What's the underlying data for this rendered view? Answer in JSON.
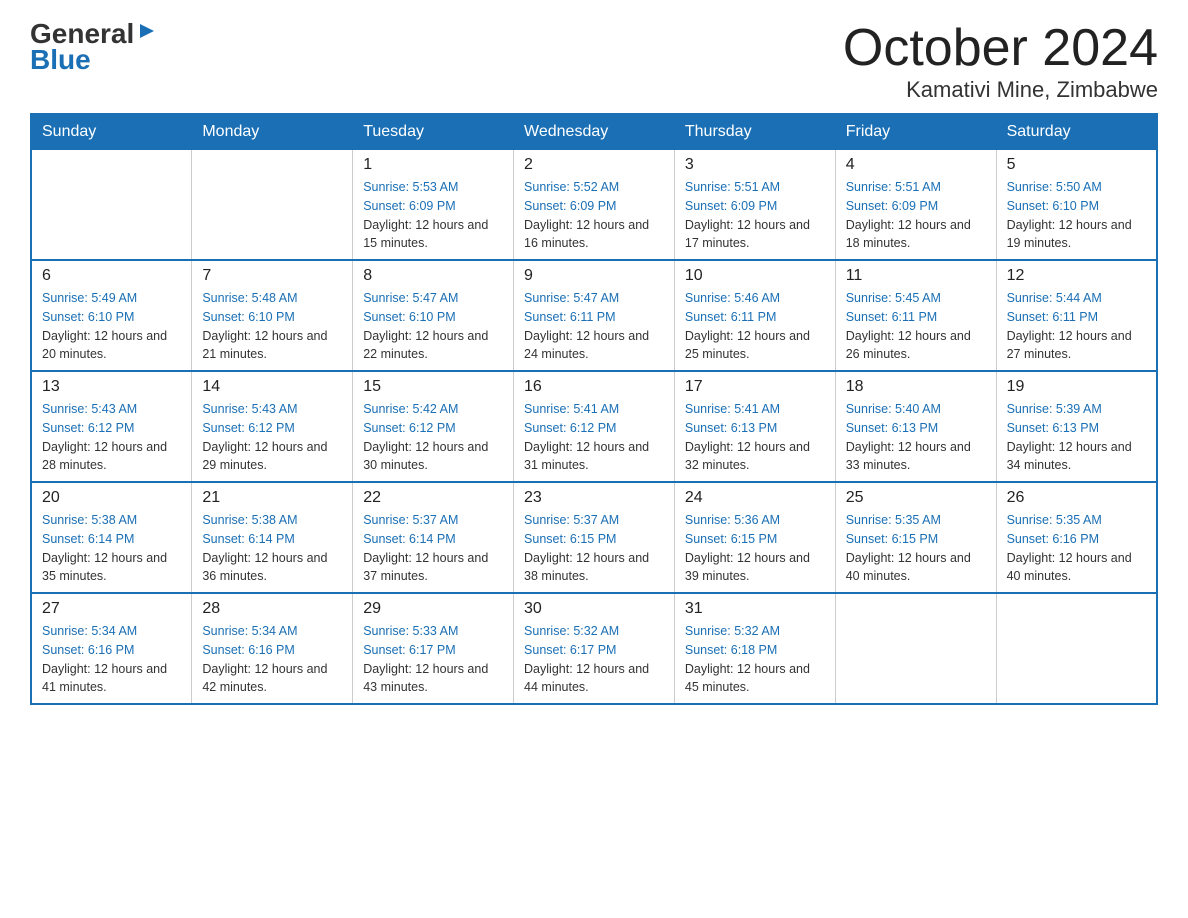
{
  "logo": {
    "general": "General",
    "arrow": "▶",
    "blue": "Blue"
  },
  "header": {
    "month": "October 2024",
    "location": "Kamativi Mine, Zimbabwe"
  },
  "days_of_week": [
    "Sunday",
    "Monday",
    "Tuesday",
    "Wednesday",
    "Thursday",
    "Friday",
    "Saturday"
  ],
  "weeks": [
    [
      {
        "day": "",
        "info": ""
      },
      {
        "day": "",
        "info": ""
      },
      {
        "day": "1",
        "sunrise": "Sunrise: 5:53 AM",
        "sunset": "Sunset: 6:09 PM",
        "daylight": "Daylight: 12 hours and 15 minutes."
      },
      {
        "day": "2",
        "sunrise": "Sunrise: 5:52 AM",
        "sunset": "Sunset: 6:09 PM",
        "daylight": "Daylight: 12 hours and 16 minutes."
      },
      {
        "day": "3",
        "sunrise": "Sunrise: 5:51 AM",
        "sunset": "Sunset: 6:09 PM",
        "daylight": "Daylight: 12 hours and 17 minutes."
      },
      {
        "day": "4",
        "sunrise": "Sunrise: 5:51 AM",
        "sunset": "Sunset: 6:09 PM",
        "daylight": "Daylight: 12 hours and 18 minutes."
      },
      {
        "day": "5",
        "sunrise": "Sunrise: 5:50 AM",
        "sunset": "Sunset: 6:10 PM",
        "daylight": "Daylight: 12 hours and 19 minutes."
      }
    ],
    [
      {
        "day": "6",
        "sunrise": "Sunrise: 5:49 AM",
        "sunset": "Sunset: 6:10 PM",
        "daylight": "Daylight: 12 hours and 20 minutes."
      },
      {
        "day": "7",
        "sunrise": "Sunrise: 5:48 AM",
        "sunset": "Sunset: 6:10 PM",
        "daylight": "Daylight: 12 hours and 21 minutes."
      },
      {
        "day": "8",
        "sunrise": "Sunrise: 5:47 AM",
        "sunset": "Sunset: 6:10 PM",
        "daylight": "Daylight: 12 hours and 22 minutes."
      },
      {
        "day": "9",
        "sunrise": "Sunrise: 5:47 AM",
        "sunset": "Sunset: 6:11 PM",
        "daylight": "Daylight: 12 hours and 24 minutes."
      },
      {
        "day": "10",
        "sunrise": "Sunrise: 5:46 AM",
        "sunset": "Sunset: 6:11 PM",
        "daylight": "Daylight: 12 hours and 25 minutes."
      },
      {
        "day": "11",
        "sunrise": "Sunrise: 5:45 AM",
        "sunset": "Sunset: 6:11 PM",
        "daylight": "Daylight: 12 hours and 26 minutes."
      },
      {
        "day": "12",
        "sunrise": "Sunrise: 5:44 AM",
        "sunset": "Sunset: 6:11 PM",
        "daylight": "Daylight: 12 hours and 27 minutes."
      }
    ],
    [
      {
        "day": "13",
        "sunrise": "Sunrise: 5:43 AM",
        "sunset": "Sunset: 6:12 PM",
        "daylight": "Daylight: 12 hours and 28 minutes."
      },
      {
        "day": "14",
        "sunrise": "Sunrise: 5:43 AM",
        "sunset": "Sunset: 6:12 PM",
        "daylight": "Daylight: 12 hours and 29 minutes."
      },
      {
        "day": "15",
        "sunrise": "Sunrise: 5:42 AM",
        "sunset": "Sunset: 6:12 PM",
        "daylight": "Daylight: 12 hours and 30 minutes."
      },
      {
        "day": "16",
        "sunrise": "Sunrise: 5:41 AM",
        "sunset": "Sunset: 6:12 PM",
        "daylight": "Daylight: 12 hours and 31 minutes."
      },
      {
        "day": "17",
        "sunrise": "Sunrise: 5:41 AM",
        "sunset": "Sunset: 6:13 PM",
        "daylight": "Daylight: 12 hours and 32 minutes."
      },
      {
        "day": "18",
        "sunrise": "Sunrise: 5:40 AM",
        "sunset": "Sunset: 6:13 PM",
        "daylight": "Daylight: 12 hours and 33 minutes."
      },
      {
        "day": "19",
        "sunrise": "Sunrise: 5:39 AM",
        "sunset": "Sunset: 6:13 PM",
        "daylight": "Daylight: 12 hours and 34 minutes."
      }
    ],
    [
      {
        "day": "20",
        "sunrise": "Sunrise: 5:38 AM",
        "sunset": "Sunset: 6:14 PM",
        "daylight": "Daylight: 12 hours and 35 minutes."
      },
      {
        "day": "21",
        "sunrise": "Sunrise: 5:38 AM",
        "sunset": "Sunset: 6:14 PM",
        "daylight": "Daylight: 12 hours and 36 minutes."
      },
      {
        "day": "22",
        "sunrise": "Sunrise: 5:37 AM",
        "sunset": "Sunset: 6:14 PM",
        "daylight": "Daylight: 12 hours and 37 minutes."
      },
      {
        "day": "23",
        "sunrise": "Sunrise: 5:37 AM",
        "sunset": "Sunset: 6:15 PM",
        "daylight": "Daylight: 12 hours and 38 minutes."
      },
      {
        "day": "24",
        "sunrise": "Sunrise: 5:36 AM",
        "sunset": "Sunset: 6:15 PM",
        "daylight": "Daylight: 12 hours and 39 minutes."
      },
      {
        "day": "25",
        "sunrise": "Sunrise: 5:35 AM",
        "sunset": "Sunset: 6:15 PM",
        "daylight": "Daylight: 12 hours and 40 minutes."
      },
      {
        "day": "26",
        "sunrise": "Sunrise: 5:35 AM",
        "sunset": "Sunset: 6:16 PM",
        "daylight": "Daylight: 12 hours and 40 minutes."
      }
    ],
    [
      {
        "day": "27",
        "sunrise": "Sunrise: 5:34 AM",
        "sunset": "Sunset: 6:16 PM",
        "daylight": "Daylight: 12 hours and 41 minutes."
      },
      {
        "day": "28",
        "sunrise": "Sunrise: 5:34 AM",
        "sunset": "Sunset: 6:16 PM",
        "daylight": "Daylight: 12 hours and 42 minutes."
      },
      {
        "day": "29",
        "sunrise": "Sunrise: 5:33 AM",
        "sunset": "Sunset: 6:17 PM",
        "daylight": "Daylight: 12 hours and 43 minutes."
      },
      {
        "day": "30",
        "sunrise": "Sunrise: 5:32 AM",
        "sunset": "Sunset: 6:17 PM",
        "daylight": "Daylight: 12 hours and 44 minutes."
      },
      {
        "day": "31",
        "sunrise": "Sunrise: 5:32 AM",
        "sunset": "Sunset: 6:18 PM",
        "daylight": "Daylight: 12 hours and 45 minutes."
      },
      {
        "day": "",
        "info": ""
      },
      {
        "day": "",
        "info": ""
      }
    ]
  ]
}
